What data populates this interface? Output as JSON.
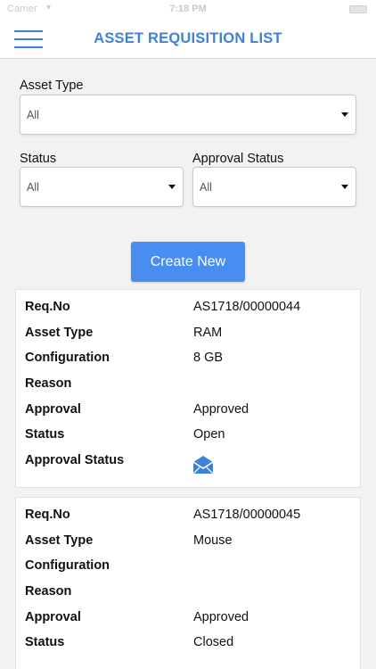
{
  "status_bar": {
    "carrier": "Carrier",
    "time": "7:18 PM"
  },
  "header": {
    "title": "ASSET REQUISITION LIST",
    "menu_icon": "hamburger-menu-icon"
  },
  "filters": {
    "asset_type": {
      "label": "Asset Type",
      "value": "All"
    },
    "status": {
      "label": "Status",
      "value": "All"
    },
    "approval_status": {
      "label": "Approval Status",
      "value": "All"
    }
  },
  "create_button": "Create New",
  "field_labels": {
    "req_no": "Req.No",
    "asset_type": "Asset Type",
    "configuration": "Configuration",
    "reason": "Reason",
    "approval": "Approval",
    "status": "Status",
    "approval_status": "Approval Status"
  },
  "requisitions": [
    {
      "req_no": "AS1718/00000044",
      "asset_type": "RAM",
      "configuration": "8 GB",
      "reason": "",
      "approval": "Approved",
      "status": "Open",
      "approval_status_icon": "envelope-icon",
      "icon_color": "#3f80d8"
    },
    {
      "req_no": "AS1718/00000045",
      "asset_type": "Mouse",
      "configuration": "",
      "reason": "",
      "approval": "Approved",
      "status": "Closed"
    }
  ]
}
